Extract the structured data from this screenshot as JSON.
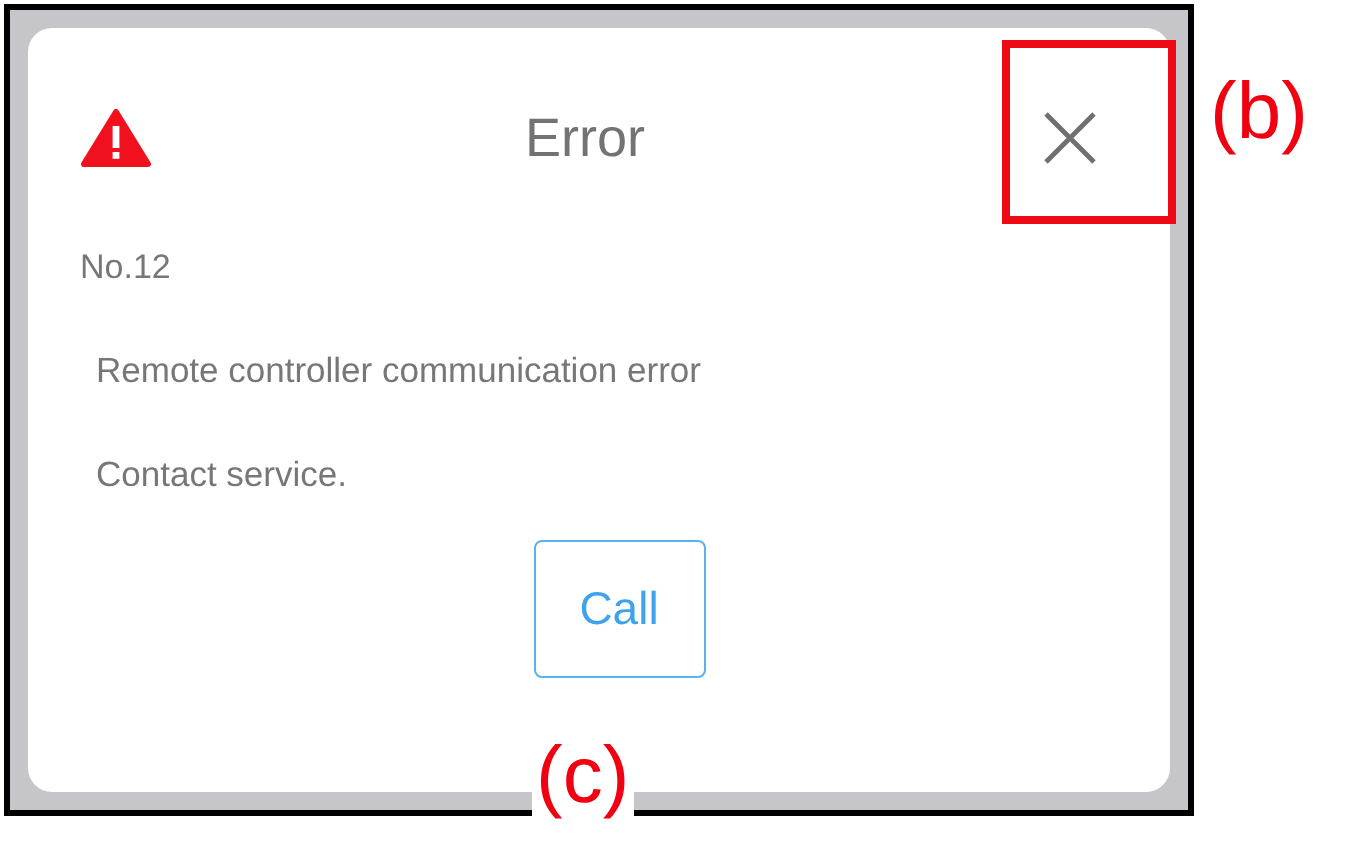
{
  "dialog": {
    "title": "Error",
    "code": "No.12",
    "message": "Remote controller communication error",
    "instruction": "Contact service.",
    "button": "Call"
  },
  "annotations": [
    {
      "kind": "close",
      "label": "(b)"
    },
    {
      "kind": "button",
      "label": "(c)"
    }
  ]
}
